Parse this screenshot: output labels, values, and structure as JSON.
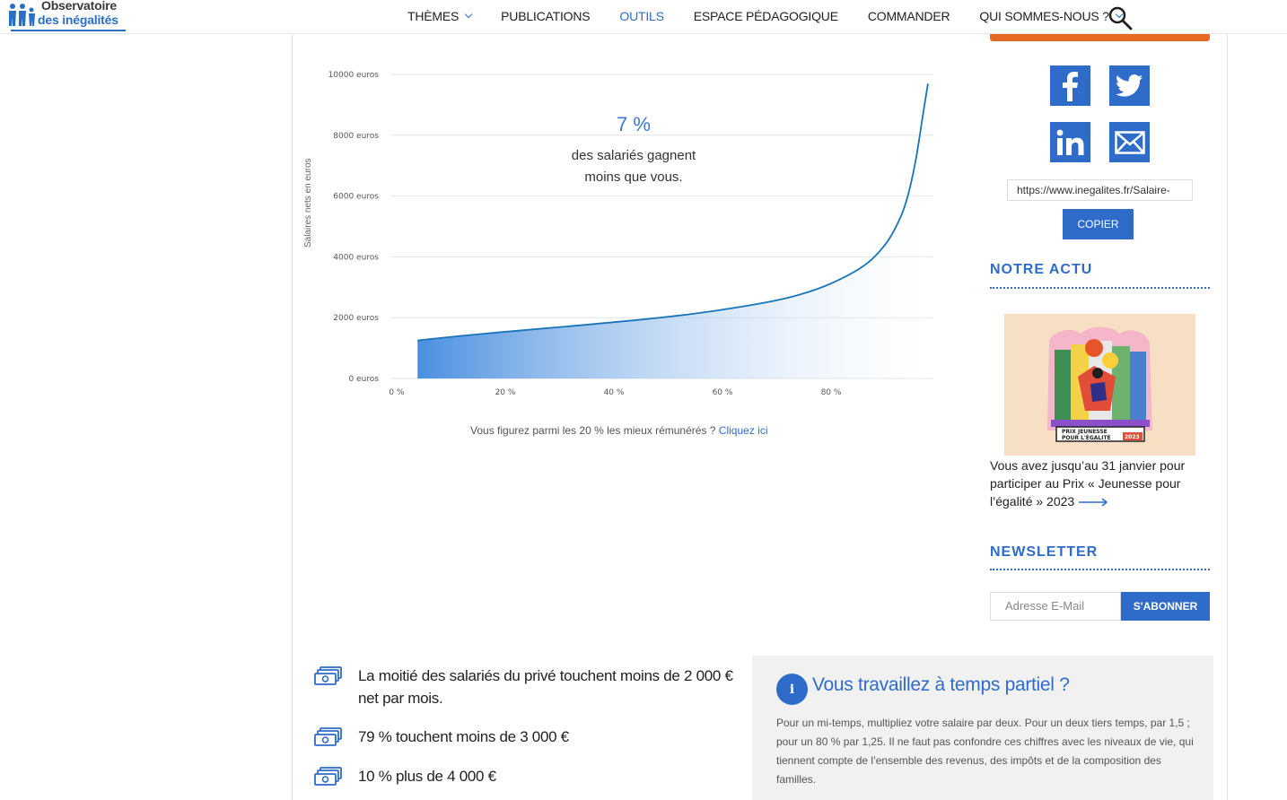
{
  "header": {
    "logo_line1": "Observatoire",
    "logo_line2": "des inégalités",
    "nav": [
      {
        "label": "THÈMES",
        "has_dropdown": true
      },
      {
        "label": "PUBLICATIONS",
        "has_dropdown": false
      },
      {
        "label": "OUTILS",
        "has_dropdown": false,
        "active": true
      },
      {
        "label": "ESPACE PÉDAGOGIQUE",
        "has_dropdown": false
      },
      {
        "label": "COMMANDER",
        "has_dropdown": false
      },
      {
        "label": "QUI SOMMES-NOUS ?",
        "has_dropdown": true
      }
    ],
    "search_icon": "search-icon"
  },
  "chart": {
    "percent": "7 %",
    "caption_line1": "des salariés gagnent",
    "caption_line2": "moins que vous.",
    "below_text": "Vous figurez parmi les 20 % les mieux rémunérés ? ",
    "below_link": "Cliquez ici"
  },
  "chart_data": {
    "type": "area",
    "ylabel": "Salaires nets en euros",
    "ylim": [
      0,
      10000
    ],
    "xlim": [
      0,
      100
    ],
    "y_ticks": [
      "0 euros",
      "2000 euros",
      "4000 euros",
      "6000 euros",
      "8000 euros",
      "10000 euros"
    ],
    "y_tick_values": [
      0,
      2000,
      4000,
      6000,
      8000,
      10000
    ],
    "x_ticks": [
      "0 %",
      "20 %",
      "40 %",
      "60 %",
      "80 %"
    ],
    "x_tick_values": [
      0,
      20,
      40,
      60,
      80
    ],
    "x": [
      5,
      10,
      20,
      30,
      40,
      50,
      60,
      70,
      75,
      80,
      85,
      88,
      90,
      92,
      94,
      95,
      96,
      97,
      98,
      99
    ],
    "values": [
      1250,
      1350,
      1520,
      1670,
      1830,
      2000,
      2220,
      2520,
      2730,
      3020,
      3450,
      3800,
      4150,
      4600,
      5300,
      5800,
      6500,
      7400,
      8600,
      9700
    ],
    "grid": true,
    "colors": {
      "line": "#1a74b8",
      "fill_start": "#4a8fe0",
      "fill_end": "#ffffff"
    }
  },
  "sidebar": {
    "social": [
      {
        "name": "facebook-icon"
      },
      {
        "name": "twitter-icon"
      },
      {
        "name": "linkedin-icon"
      },
      {
        "name": "mail-icon"
      }
    ],
    "url": "https://www.inegalites.fr/Salaire-",
    "copy_label": "COPIER",
    "actu_title": "NOTRE ACTU",
    "actu_text": "Vous avez jusqu’au 31 janvier pour participer au Prix « Jeunesse pour l’égalité » 2023",
    "actu_image_lines": [
      "PRIX JEUNESSE",
      "POUR L'ÉGALITÉ",
      "2023"
    ],
    "newsletter_title": "NEWSLETTER",
    "email_placeholder": "Adresse E-Mail",
    "subscribe_label": "S'ABONNER"
  },
  "stats": [
    "La moitié des salariés du privé touchent moins de 2 000 € net par mois.",
    "79 % touchent moins de 3 000 €",
    "10 % plus de 4 000 €"
  ],
  "info": {
    "icon": "i",
    "title": "Vous travaillez à temps partiel ?",
    "text": "Pour un mi-temps, multipliez votre salaire par deux. Pour un deux tiers temps, par 1,5 ; pour un 80 % par 1,25. Il ne faut pas confondre ces chiffres avec les niveaux de vie, qui tiennent compte de l’ensemble des revenus, des impôts et de la composition des familles."
  },
  "colors": {
    "accent": "#2f6cc9",
    "orange": "#e66a26",
    "info_bg": "#f1f1f1"
  }
}
